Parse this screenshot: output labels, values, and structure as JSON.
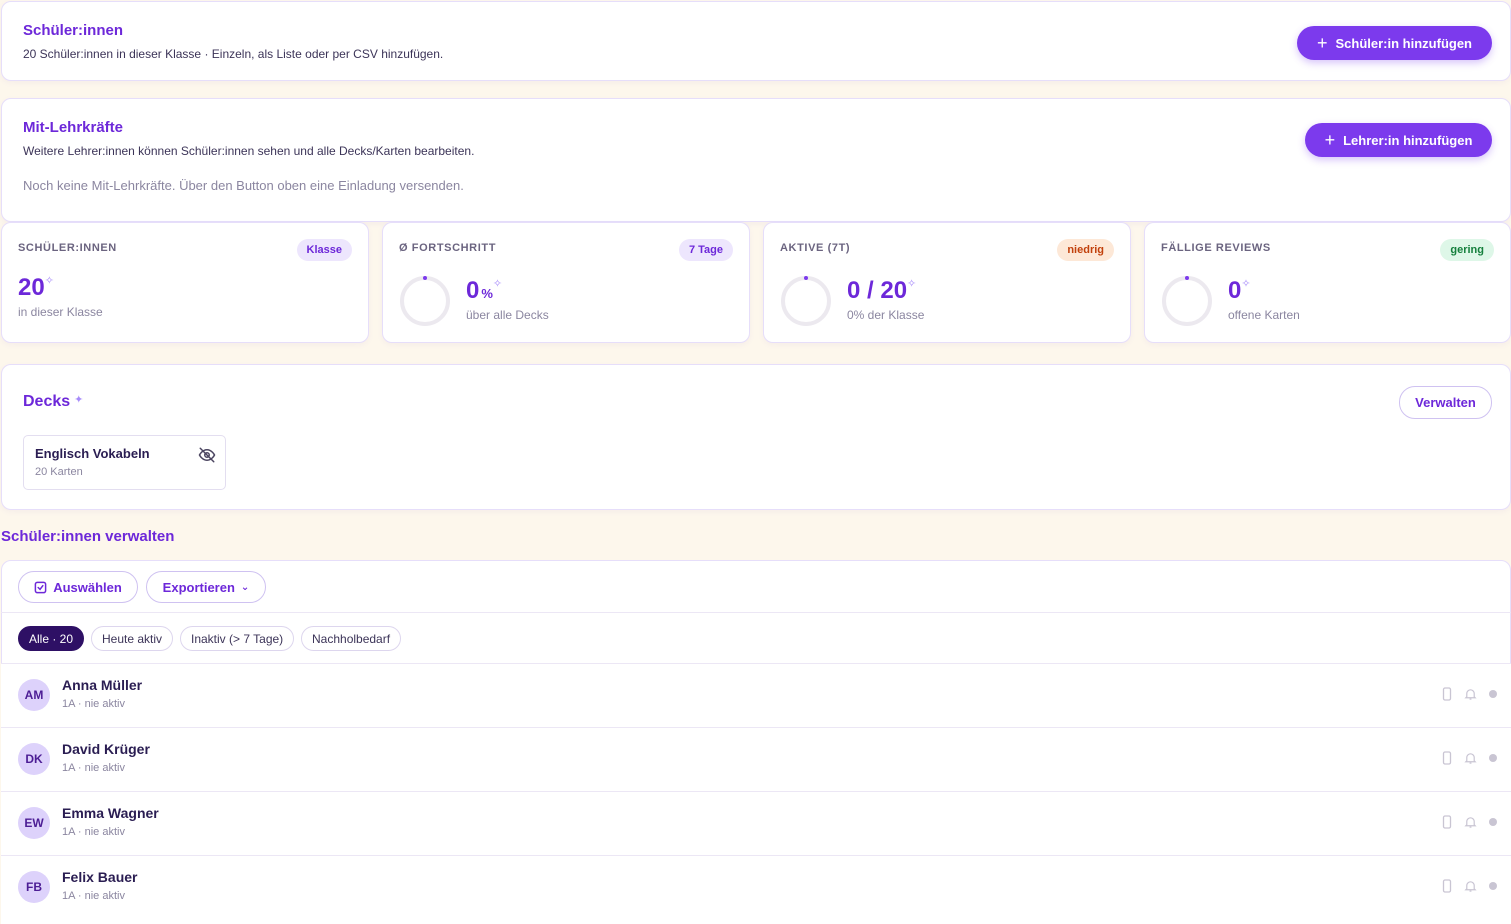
{
  "students_card": {
    "title": "Schüler:innen",
    "subtitle": "20 Schüler:innen in dieser Klasse · Einzeln, als Liste oder per CSV hinzufügen.",
    "add_button": "Schüler:in hinzufügen"
  },
  "coteachers_card": {
    "title": "Mit-Lehrkräfte",
    "subtitle": "Weitere Lehrer:innen können Schüler:innen sehen und alle Decks/Karten bearbeiten.",
    "empty_text": "Noch keine Mit-Lehrkräfte. Über den Button oben eine Einladung versenden.",
    "add_button": "Lehrer:in hinzufügen"
  },
  "stats": [
    {
      "label": "SCHÜLER:INNEN",
      "badge": "Klasse",
      "value": "20",
      "unit": "",
      "caption": "in dieser Klasse",
      "progress": 0
    },
    {
      "label": "Ø FORTSCHRITT",
      "badge": "7 Tage",
      "value": "0",
      "unit": "%",
      "caption": "über alle Decks",
      "progress": 0
    },
    {
      "label": "AKTIVE (7T)",
      "badge": "niedrig",
      "value": "0 / 20",
      "unit": "",
      "caption": "0% der Klasse",
      "progress": 0
    },
    {
      "label": "FÄLLIGE REVIEWS",
      "badge": "gering",
      "value": "0",
      "unit": "",
      "caption": "offene Karten",
      "progress": 0
    }
  ],
  "decks_card": {
    "title": "Decks",
    "manage_button": "Verwalten",
    "decks": [
      {
        "name": "Englisch Vokabeln",
        "count": "20 Karten"
      }
    ]
  },
  "manage_students": {
    "heading": "Schüler:innen verwalten",
    "select_button": "Auswählen",
    "export_button": "Exportieren",
    "filters": [
      "Alle · 20",
      "Heute aktiv",
      "Inaktiv (> 7 Tage)",
      "Nachholbedarf"
    ],
    "rows": [
      {
        "initials": "AM",
        "name": "Anna Müller",
        "meta": "1A · nie aktiv"
      },
      {
        "initials": "DK",
        "name": "David Krüger",
        "meta": "1A · nie aktiv"
      },
      {
        "initials": "EW",
        "name": "Emma Wagner",
        "meta": "1A · nie aktiv"
      },
      {
        "initials": "FB",
        "name": "Felix Bauer",
        "meta": "1A · nie aktiv"
      }
    ]
  },
  "colors": {
    "accent": "#7c3aed",
    "accent_dark": "#2e1065",
    "background": "#fdf7ec"
  }
}
